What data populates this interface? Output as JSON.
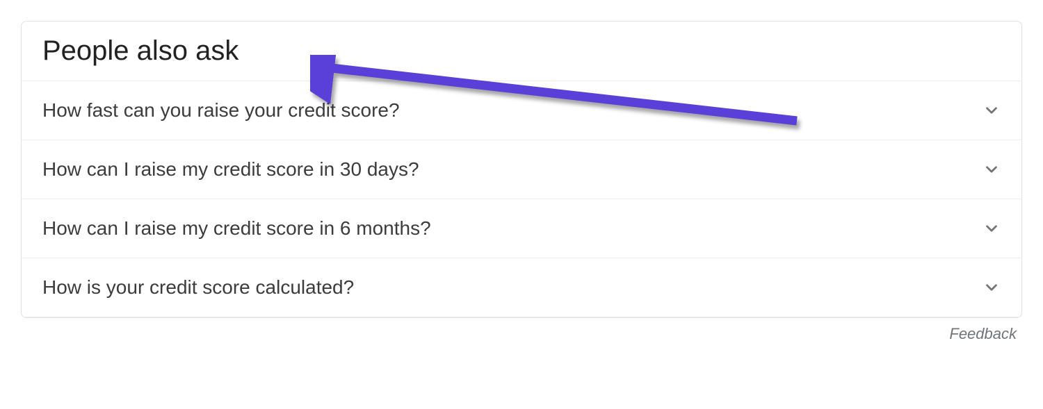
{
  "paa": {
    "title": "People also ask",
    "questions": [
      {
        "text": "How fast can you raise your credit score?"
      },
      {
        "text": "How can I raise my credit score in 30 days?"
      },
      {
        "text": "How can I raise my credit score in 6 months?"
      },
      {
        "text": "How is your credit score calculated?"
      }
    ],
    "feedback_label": "Feedback"
  },
  "annotation": {
    "arrow_color": "#5b3fd9"
  }
}
